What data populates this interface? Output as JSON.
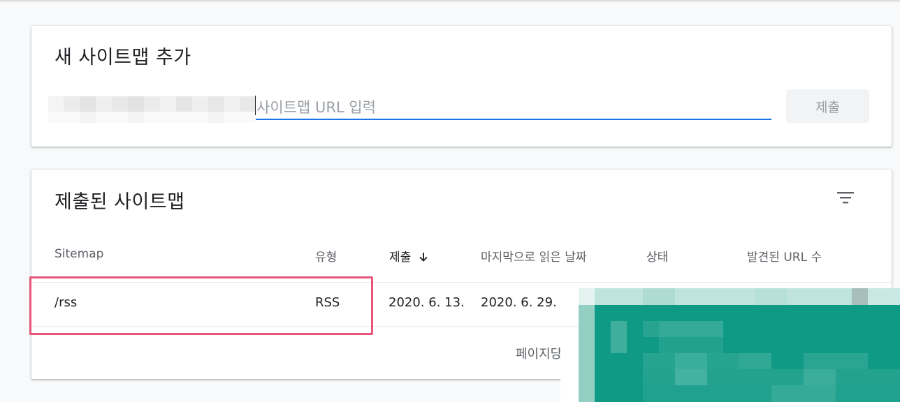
{
  "add_sitemap": {
    "title": "새 사이트맵 추가",
    "input_value": "",
    "input_placeholder": "사이트맵 URL 입력",
    "submit_label": "제출"
  },
  "submitted": {
    "title": "제출된 사이트맵",
    "filter_icon": "filter-list-icon",
    "columns": {
      "sitemap": "Sitemap",
      "type": "유형",
      "submitted": "제출",
      "last_read": "마지막으로 읽은 날짜",
      "status": "상태",
      "discovered_urls": "발견된 URL 수"
    },
    "sort_icon": "arrow-down-icon",
    "rows": [
      {
        "sitemap": "/rss",
        "type": "RSS",
        "submitted": "2020. 6. 13.",
        "last_read": "2020. 6. 29."
      }
    ],
    "pagination": {
      "rows_per_page_label": "페이지당"
    }
  },
  "colors": {
    "accent": "#1a73e8",
    "highlight_border": "#e8557a",
    "mosaic_teal": "#0f9a86"
  }
}
